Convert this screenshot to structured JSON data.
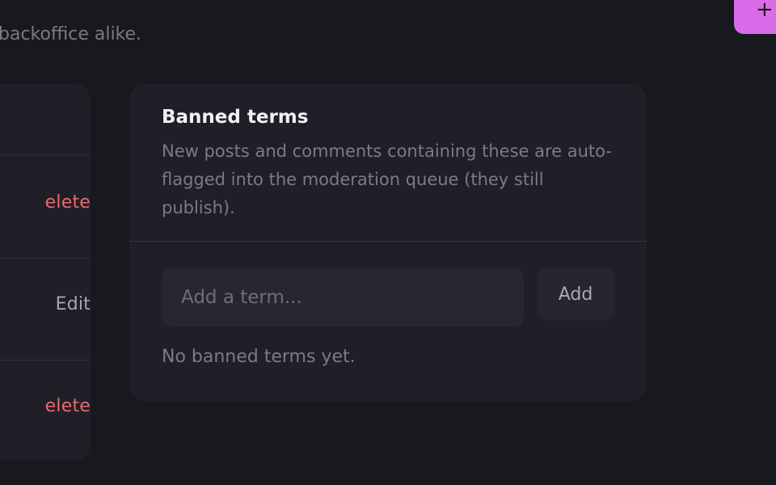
{
  "header": {
    "subtitle": "backoffice alike."
  },
  "fab": {
    "icon": "plus-icon",
    "glyph": "+",
    "color": "#da6ce9"
  },
  "left_panel": {
    "rows": [
      {
        "action_label": "elete",
        "action_type": "delete"
      },
      {
        "action_label": "Edit",
        "action_type": "edit"
      },
      {
        "action_label": "elete",
        "action_type": "delete"
      }
    ]
  },
  "banned_terms": {
    "title": "Banned terms",
    "description": "New posts and comments containing these are auto-flagged into the moderation queue (they still publish).",
    "input": {
      "value": "",
      "placeholder": "Add a term..."
    },
    "add_label": "Add",
    "empty_text": "No banned terms yet."
  },
  "colors": {
    "background": "#18181f",
    "card": "#1f1f28",
    "accent": "#da6ce9",
    "danger": "#e86a6a"
  }
}
